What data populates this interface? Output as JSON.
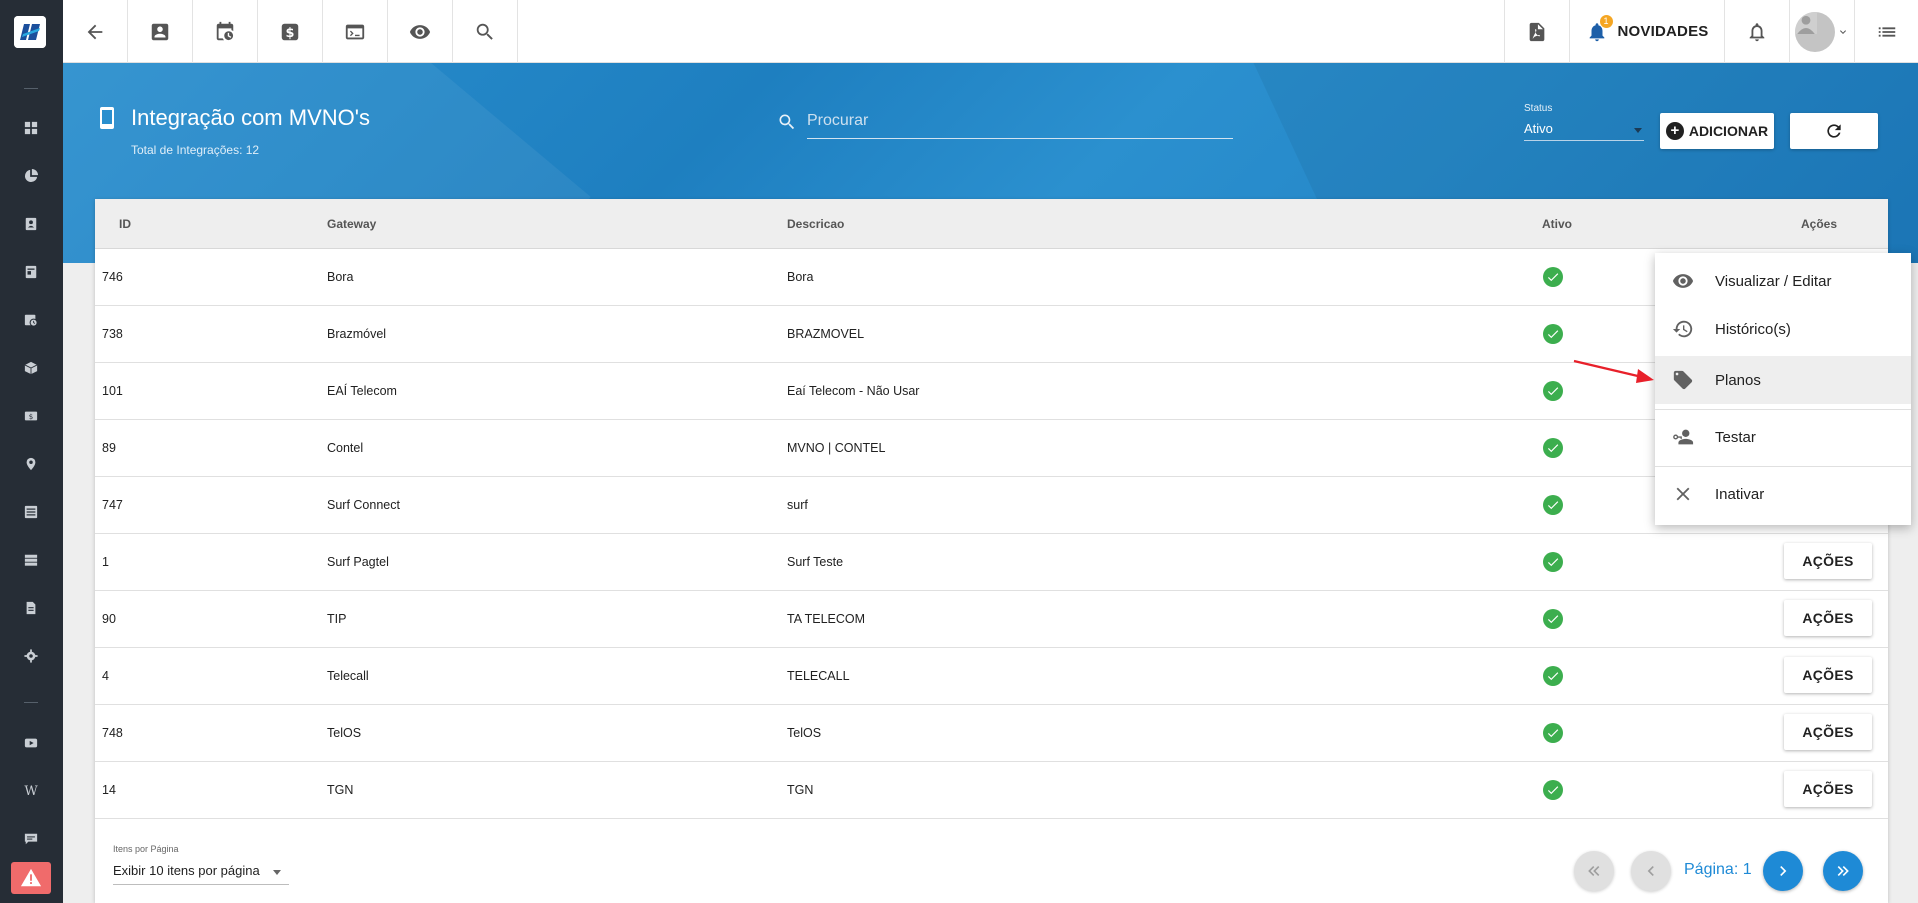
{
  "topbar": {
    "novidades_label": "NOVIDADES",
    "novidades_badge": "1"
  },
  "header": {
    "title": "Integração com MVNO's",
    "subtitle": "Total de Integrações: 12",
    "search_placeholder": "Procurar",
    "status_label": "Status",
    "status_value": "Ativo",
    "add_label": "ADICIONAR"
  },
  "table": {
    "columns": [
      "ID",
      "Gateway",
      "Descricao",
      "Ativo",
      "Ações"
    ],
    "action_label": "AÇÕES",
    "rows": [
      {
        "id": "746",
        "gateway": "Bora",
        "descricao": "Bora",
        "ativo": true
      },
      {
        "id": "738",
        "gateway": "Brazmóvel",
        "descricao": "BRAZMOVEL",
        "ativo": true
      },
      {
        "id": "101",
        "gateway": "EAÍ Telecom",
        "descricao": "Eaí Telecom - Não Usar",
        "ativo": true
      },
      {
        "id": "89",
        "gateway": "Contel",
        "descricao": "MVNO | CONTEL",
        "ativo": true
      },
      {
        "id": "747",
        "gateway": "Surf Connect",
        "descricao": "surf",
        "ativo": true
      },
      {
        "id": "1",
        "gateway": "Surf Pagtel",
        "descricao": "Surf Teste",
        "ativo": true
      },
      {
        "id": "90",
        "gateway": "TIP",
        "descricao": "TA TELECOM",
        "ativo": true
      },
      {
        "id": "4",
        "gateway": "Telecall",
        "descricao": "TELECALL",
        "ativo": true
      },
      {
        "id": "748",
        "gateway": "TelOS",
        "descricao": "TelOS",
        "ativo": true
      },
      {
        "id": "14",
        "gateway": "TGN",
        "descricao": "TGN",
        "ativo": true
      }
    ]
  },
  "footer": {
    "items_label": "Itens por Página",
    "items_value": "Exibir 10 itens por página",
    "page_label": "Página: 1"
  },
  "menu": {
    "items": [
      {
        "label": "Visualizar / Editar",
        "icon": "eye-icon"
      },
      {
        "label": "Histórico(s)",
        "icon": "history-icon"
      },
      {
        "label": "Planos",
        "icon": "tags-icon"
      },
      {
        "label": "Testar",
        "icon": "user-key-icon"
      },
      {
        "label": "Inativar",
        "icon": "close-icon"
      }
    ],
    "highlighted": "Planos"
  },
  "colors": {
    "sidebar": "#262d36",
    "header_blue": "#2a8fce",
    "check_green": "#3cae4e",
    "pagination_blue": "#1e8ad6",
    "alert_red": "#f06b6b",
    "annotation_arrow": "#e8202a"
  }
}
